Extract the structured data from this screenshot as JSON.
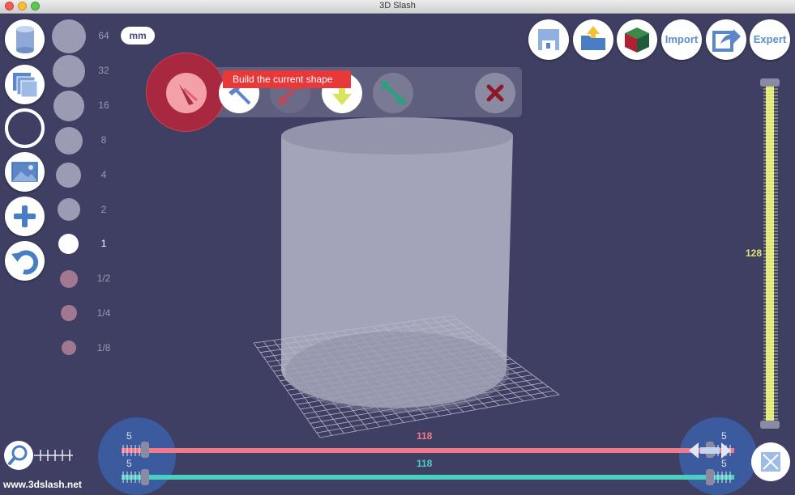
{
  "window": {
    "title": "3D Slash"
  },
  "units": {
    "label": "mm"
  },
  "sizes": [
    "64",
    "32",
    "16",
    "8",
    "4",
    "2",
    "1",
    "1/2",
    "1/4",
    "1/8"
  ],
  "selected_size": "1",
  "toolbar": {
    "tooltip": "Build the current shape"
  },
  "right_buttons": {
    "import_label": "Import",
    "expert_label": "Expert"
  },
  "vertical_slider": {
    "value": "128"
  },
  "horizontal_sliders": {
    "red_value": "118",
    "teal_value": "118",
    "left_top": "5",
    "left_bottom": "5",
    "right_top": "5",
    "right_bottom": "5"
  },
  "website": "www.3dslash.net",
  "colors": {
    "background": "#3f3f63",
    "accent_red": "#e8383a",
    "yellow": "#dfe86a",
    "teal": "#48d0c0",
    "pink": "#f07a8a"
  },
  "icons": {
    "left": [
      "cylinder-icon",
      "layers-icon",
      "circle-icon",
      "image-icon",
      "plus-icon",
      "undo-icon"
    ],
    "right": [
      "save-icon",
      "open-folder-icon",
      "color-cube-icon",
      "import-icon",
      "export-icon",
      "expert-icon"
    ],
    "tools": [
      "build-tool-icon",
      "hammer-icon",
      "red-diagonal-arrows-icon",
      "yellow-down-arrow-icon",
      "green-diagonal-arrows-icon",
      "close-icon"
    ]
  }
}
